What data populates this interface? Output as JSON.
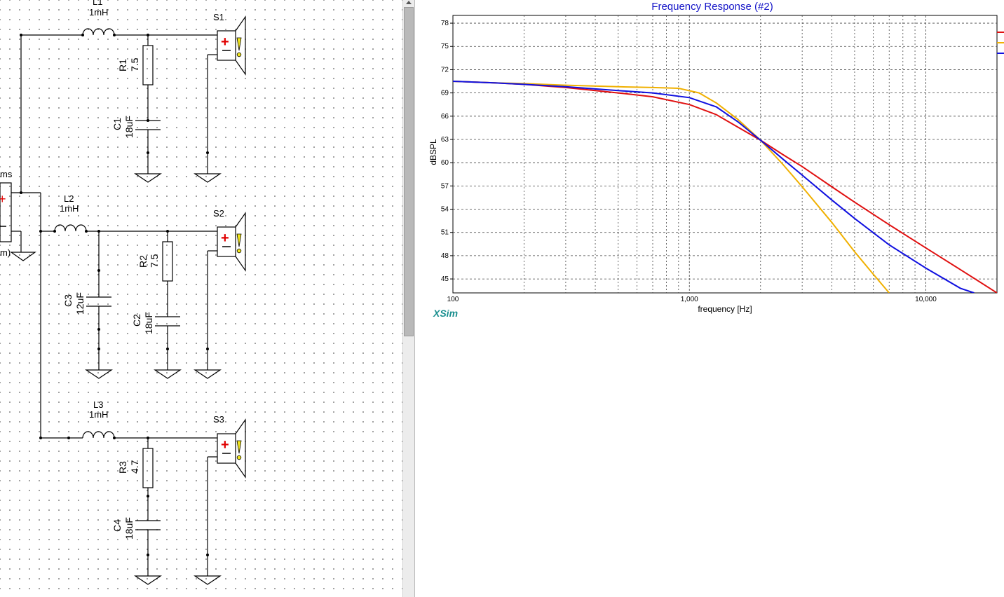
{
  "schematic": {
    "inductors": [
      {
        "ref": "L1",
        "value": "1mH"
      },
      {
        "ref": "L2",
        "value": "1mH"
      },
      {
        "ref": "L3",
        "value": "1mH"
      }
    ],
    "resistors": [
      {
        "ref": "R1",
        "value": "7.5"
      },
      {
        "ref": "R2",
        "value": "7.5"
      },
      {
        "ref": "R3",
        "value": "4.7"
      }
    ],
    "capacitors": [
      {
        "ref": "C1",
        "value": "18uF"
      },
      {
        "ref": "C2",
        "value": "18uF"
      },
      {
        "ref": "C3",
        "value": "12uF"
      },
      {
        "ref": "C4",
        "value": "18uF"
      }
    ],
    "speakers": [
      {
        "ref": "S1"
      },
      {
        "ref": "S2"
      },
      {
        "ref": "S3"
      }
    ],
    "source_label_partial": "ms",
    "source_label_partial2": "m)"
  },
  "graph": {
    "title": "Frequency Response (#2)",
    "watermark": "XSim",
    "colors": {
      "red": "#e01010",
      "yellow": "#f0b000",
      "blue": "#1010e0",
      "title": "#1515c8",
      "watermark": "#1a8f8f"
    }
  },
  "chart_data": {
    "type": "line",
    "title": "Frequency Response (#2)",
    "xlabel": "frequency [Hz]",
    "ylabel": "dBSPL",
    "xscale": "log",
    "xlim": [
      100,
      20000
    ],
    "ylim": [
      43.2,
      79.0
    ],
    "xticks": [
      {
        "v": 100,
        "label": "100"
      },
      {
        "v": 1000,
        "label": "1,000"
      },
      {
        "v": 10000,
        "label": "10,000"
      }
    ],
    "yticks": [
      45,
      48,
      51,
      54,
      57,
      60,
      63,
      66,
      69,
      72,
      75,
      78
    ],
    "grid": true,
    "series": [
      {
        "color": "red",
        "x": [
          100,
          150,
          200,
          300,
          500,
          700,
          1000,
          1300,
          1600,
          2000,
          2500,
          3000,
          4000,
          5000,
          7000,
          10000,
          14000,
          20000
        ],
        "y": [
          70.5,
          70.3,
          70.1,
          69.7,
          69.0,
          68.5,
          67.5,
          66.2,
          64.6,
          62.9,
          61.0,
          59.5,
          56.9,
          54.9,
          52.0,
          49.0,
          46.2,
          43.2
        ]
      },
      {
        "color": "yellow",
        "x": [
          100,
          150,
          200,
          300,
          500,
          700,
          900,
          1100,
          1300,
          1600,
          2000,
          2500,
          3000,
          4000,
          5000,
          6000,
          7000
        ],
        "y": [
          70.5,
          70.3,
          70.2,
          70.0,
          69.8,
          69.7,
          69.6,
          69.0,
          67.7,
          65.6,
          62.9,
          59.7,
          56.9,
          52.3,
          48.5,
          45.6,
          43.2
        ]
      },
      {
        "color": "blue",
        "x": [
          100,
          150,
          200,
          300,
          500,
          700,
          1000,
          1300,
          1600,
          2000,
          2500,
          3000,
          4000,
          5000,
          7000,
          10000,
          14000,
          16000
        ],
        "y": [
          70.5,
          70.3,
          70.1,
          69.8,
          69.3,
          69.0,
          68.4,
          67.2,
          65.3,
          62.9,
          60.4,
          58.4,
          55.2,
          52.8,
          49.4,
          46.4,
          43.8,
          43.2
        ]
      }
    ]
  }
}
